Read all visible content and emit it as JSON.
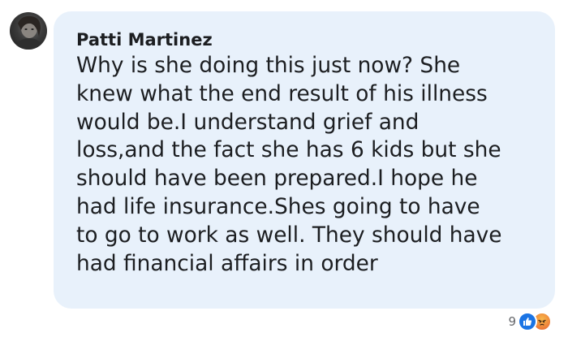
{
  "comment": {
    "author": "Patti Martinez",
    "text_lines": [
      "Why is she doing this just now? She",
      "knew what the end result of his illness",
      "would be.I understand grief and",
      "loss,and the fact she has 6 kids but she",
      "should have been prepared.I hope he",
      "had life insurance.Shes going to have",
      "to go to work as well. They should have",
      "had financial affairs in order"
    ],
    "reactions": {
      "count": "9",
      "icons": [
        "like-icon",
        "angry-icon"
      ]
    }
  },
  "colors": {
    "bubble_background": "#e8f1fb",
    "text": "#1c1e21",
    "like": "#1b74e4",
    "angry": "#f08a3c",
    "reaction_count": "#65676b"
  }
}
